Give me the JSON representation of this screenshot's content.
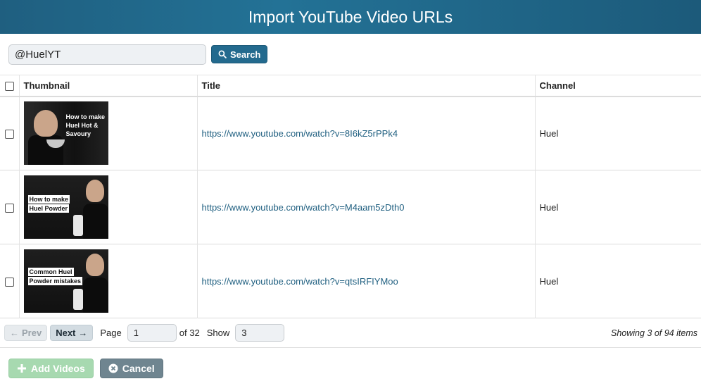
{
  "header": {
    "title": "Import YouTube Video URLs"
  },
  "search": {
    "value": "@HuelYT",
    "button_label": "Search",
    "icon": "search-icon"
  },
  "table": {
    "columns": {
      "thumbnail": "Thumbnail",
      "title": "Title",
      "channel": "Channel"
    },
    "rows": [
      {
        "thumb_caption": [
          "How to make",
          "Huel Hot &",
          "Savoury"
        ],
        "url": "https://www.youtube.com/watch?v=8I6kZ5rPPk4",
        "channel": "Huel"
      },
      {
        "thumb_caption": [
          "How to make",
          "Huel Powder"
        ],
        "url": "https://www.youtube.com/watch?v=M4aam5zDth0",
        "channel": "Huel"
      },
      {
        "thumb_caption": [
          "Common Huel",
          "Powder mistakes"
        ],
        "url": "https://www.youtube.com/watch?v=qtsIRFIYMoo",
        "channel": "Huel"
      }
    ]
  },
  "pager": {
    "prev_label": "Prev",
    "next_label": "Next",
    "page_label": "Page",
    "page_value": "1",
    "of_label": "of 32",
    "show_label": "Show",
    "show_value": "3",
    "summary": "Showing 3 of 94 items"
  },
  "footer": {
    "add_label": "Add Videos",
    "cancel_label": "Cancel"
  },
  "colors": {
    "header": "#237296",
    "link": "#1f5f80",
    "add_button": "#a7d9b0",
    "cancel_button": "#6f8590"
  }
}
